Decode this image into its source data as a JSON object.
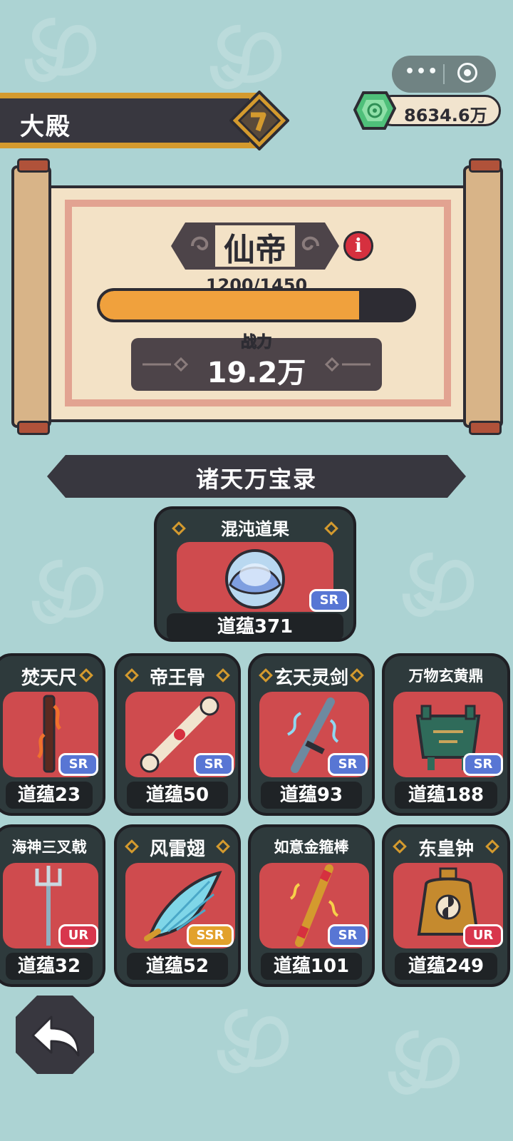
{
  "header": {
    "title": "大殿"
  },
  "miniapp": {
    "more_icon": "more-dots-icon",
    "close_icon": "target-icon"
  },
  "currency": {
    "amount": "8634.6万",
    "icon": "jade-gem-icon"
  },
  "rank": {
    "name": "仙帝",
    "info_icon": "info-icon"
  },
  "progress": {
    "label": "1200/1450",
    "current": 1200,
    "max": 1450
  },
  "power": {
    "label": "战力",
    "value": "19.2万"
  },
  "section": {
    "title": "诸天万宝录"
  },
  "featured": {
    "name": "混沌道果",
    "rarity": "SR",
    "value": "道蕴371",
    "icon": "chaos-fruit-icon"
  },
  "treasures": [
    {
      "name": "焚天尺",
      "rarity": "SR",
      "value": "道蕴23",
      "icon": "fire-ruler-icon"
    },
    {
      "name": "帝王骨",
      "rarity": "SR",
      "value": "道蕴50",
      "icon": "emperor-bone-icon"
    },
    {
      "name": "玄天灵剑",
      "rarity": "SR",
      "value": "道蕴93",
      "icon": "spirit-sword-icon"
    },
    {
      "name": "万物玄黄鼎",
      "rarity": "SR",
      "value": "道蕴188",
      "icon": "bronze-cauldron-icon"
    },
    {
      "name": "海神三叉戟",
      "rarity": "UR",
      "value": "道蕴32",
      "icon": "trident-icon"
    },
    {
      "name": "风雷翅",
      "rarity": "SSR",
      "value": "道蕴52",
      "icon": "thunder-wing-icon"
    },
    {
      "name": "如意金箍棒",
      "rarity": "SR",
      "value": "道蕴101",
      "icon": "golden-staff-icon"
    },
    {
      "name": "东皇钟",
      "rarity": "UR",
      "value": "道蕴249",
      "icon": "east-emperor-bell-icon"
    }
  ],
  "back_icon": "back-arrow-icon",
  "colors": {
    "background": "#acd3d3",
    "card": "#2e3a3c",
    "art": "#cf4b4e",
    "sr": "#5876d4",
    "ur": "#d8364d",
    "ssr": "#e2a12c",
    "progress": "#f0a13d"
  }
}
